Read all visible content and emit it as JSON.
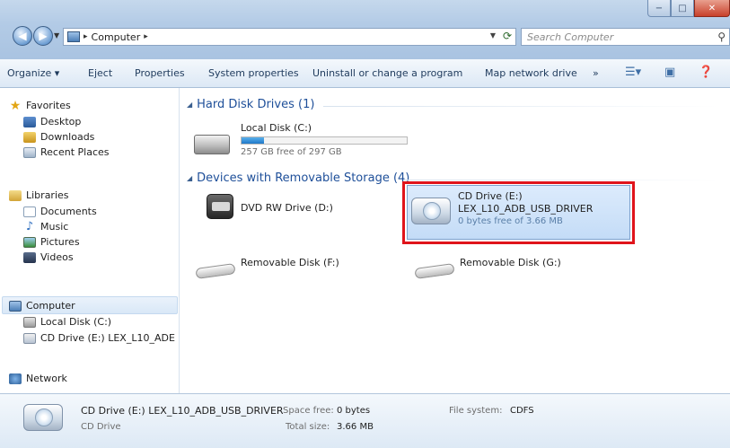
{
  "window": {
    "controls": {
      "minimize": "−",
      "maximize": "□",
      "close": "✕"
    }
  },
  "address_bar": {
    "crumb": "Computer",
    "separator": "▸"
  },
  "search": {
    "placeholder": "Search Computer"
  },
  "toolbar": {
    "organize": "Organize ▾",
    "eject": "Eject",
    "properties": "Properties",
    "system_properties": "System properties",
    "uninstall": "Uninstall or change a program",
    "map_drive": "Map network drive",
    "more": "»"
  },
  "nav": {
    "favorites": "Favorites",
    "desktop": "Desktop",
    "downloads": "Downloads",
    "recent": "Recent Places",
    "libraries": "Libraries",
    "documents": "Documents",
    "music": "Music",
    "pictures": "Pictures",
    "videos": "Videos",
    "computer": "Computer",
    "local_disk": "Local Disk (C:)",
    "cd_drive": "CD Drive (E:) LEX_L10_ADE",
    "network": "Network"
  },
  "groups": {
    "hard_disks": "Hard Disk Drives (1)",
    "removable": "Devices with Removable Storage (4)"
  },
  "drives": {
    "c": {
      "name": "Local Disk (C:)",
      "free": "257 GB free of 297 GB",
      "used_fraction": 0.135
    },
    "d": {
      "name": "DVD RW Drive (D:)"
    },
    "e": {
      "name": "CD Drive (E:)",
      "label": "LEX_L10_ADB_USB_DRIVER",
      "free": "0 bytes free of 3.66 MB"
    },
    "f": {
      "name": "Removable Disk (F:)"
    },
    "g": {
      "name": "Removable Disk (G:)"
    }
  },
  "details": {
    "title": "CD Drive (E:) LEX_L10_ADB_USB_DRIVER",
    "type": "CD Drive",
    "space_free_label": "Space free:",
    "space_free": "0 bytes",
    "total_size_label": "Total size:",
    "total_size": "3.66 MB",
    "fs_label": "File system:",
    "fs": "CDFS"
  },
  "highlight_color": "#e0141b"
}
